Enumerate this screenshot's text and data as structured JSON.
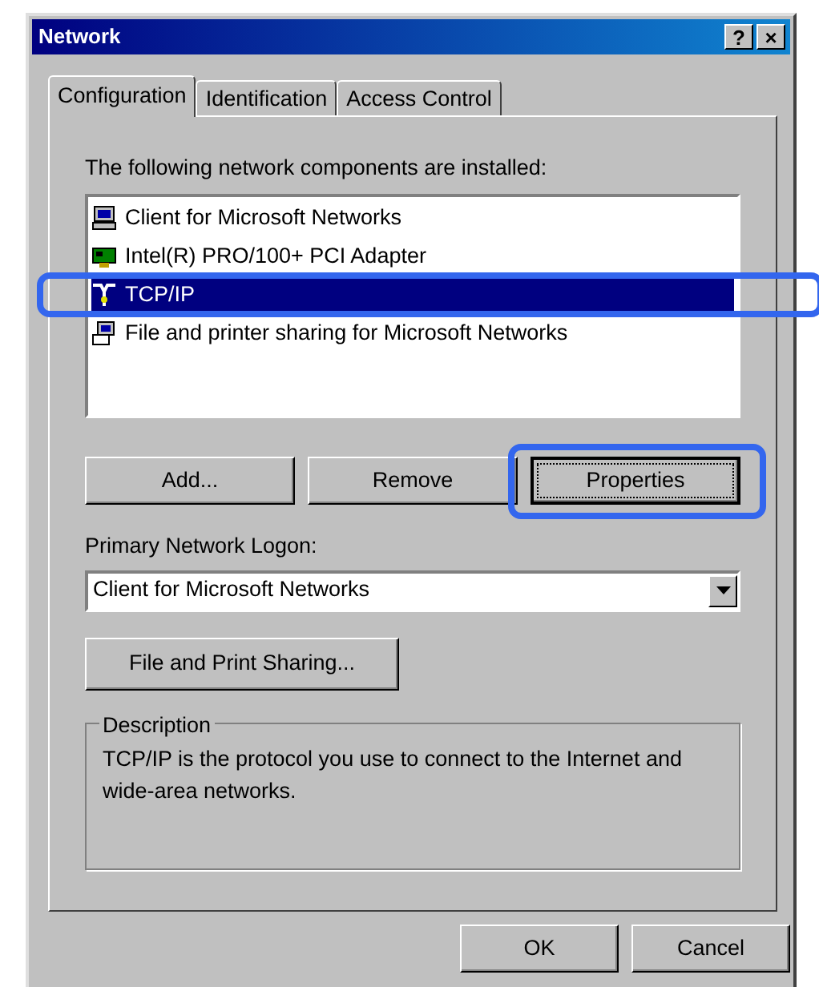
{
  "window": {
    "title": "Network"
  },
  "title_buttons": [
    {
      "kind": "help",
      "label": "?"
    },
    {
      "kind": "close",
      "label": "×"
    }
  ],
  "tabs": [
    {
      "label": "Configuration",
      "selected": true
    },
    {
      "label": "Identification",
      "selected": false
    },
    {
      "label": "Access Control",
      "selected": false
    }
  ],
  "components_label": "The following network components are installed:",
  "components": [
    {
      "kind": "client",
      "label": "Client for Microsoft Networks",
      "selected": false,
      "highlighted": false
    },
    {
      "kind": "adapter",
      "label": "Intel(R) PRO/100+ PCI Adapter",
      "selected": false,
      "highlighted": false
    },
    {
      "kind": "protocol",
      "label": "TCP/IP",
      "selected": true,
      "highlighted": true
    },
    {
      "kind": "service",
      "label": "File and printer sharing for Microsoft Networks",
      "selected": false,
      "highlighted": false
    }
  ],
  "component_buttons": [
    {
      "label": "Add...",
      "focused": false,
      "highlighted": false
    },
    {
      "label": "Remove",
      "focused": false,
      "highlighted": false
    },
    {
      "label": "Properties",
      "focused": true,
      "highlighted": true
    }
  ],
  "logon_label": "Primary Network Logon:",
  "logon_value": "Client for Microsoft Networks",
  "sharing_button": "File and Print Sharing...",
  "description": {
    "title": "Description",
    "text": "TCP/IP is the protocol you use to connect to the Internet and wide-area networks."
  },
  "dialog_buttons": [
    "OK",
    "Cancel"
  ]
}
